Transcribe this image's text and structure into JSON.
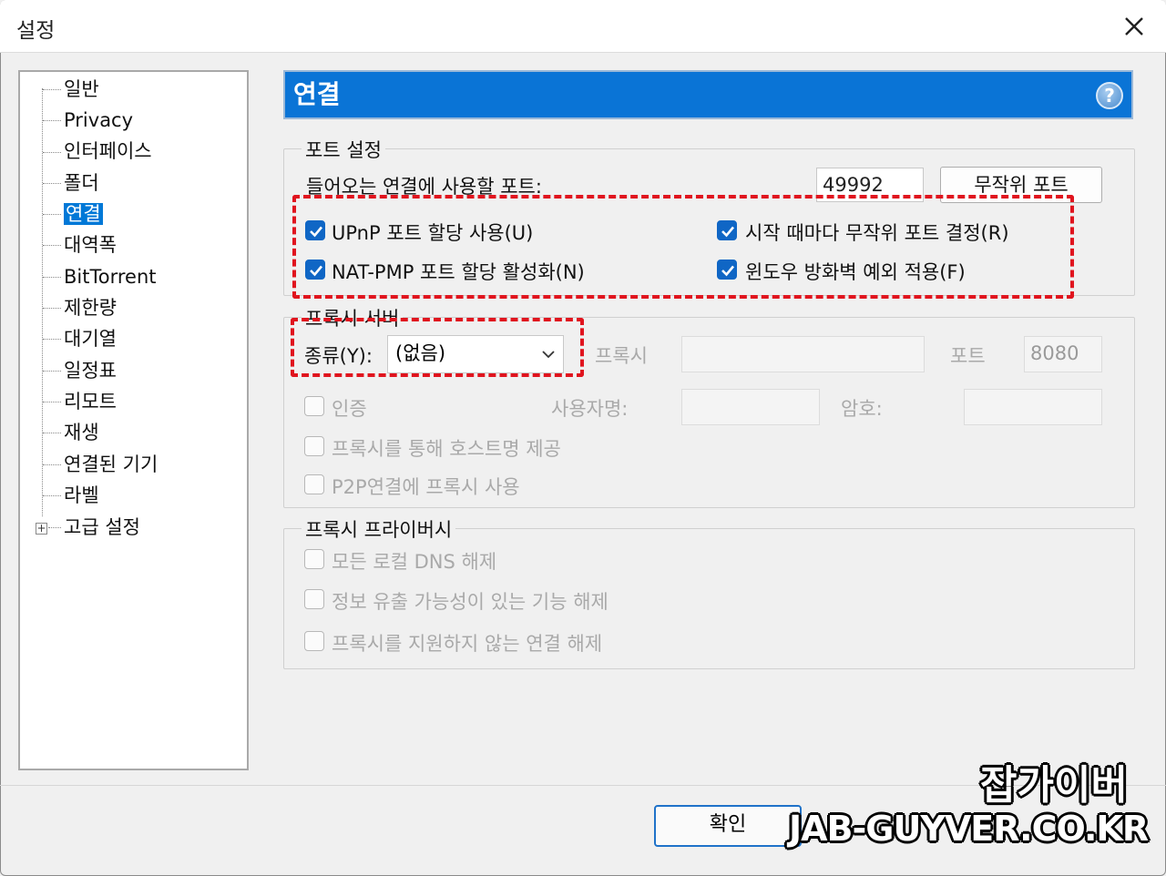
{
  "window": {
    "title": "설정"
  },
  "tree": {
    "items": [
      {
        "label": "일반"
      },
      {
        "label": "Privacy"
      },
      {
        "label": "인터페이스"
      },
      {
        "label": "폴더"
      },
      {
        "label": "연결"
      },
      {
        "label": "대역폭"
      },
      {
        "label": "BitTorrent"
      },
      {
        "label": "제한량"
      },
      {
        "label": "대기열"
      },
      {
        "label": "일정표"
      },
      {
        "label": "리모트"
      },
      {
        "label": "재생"
      },
      {
        "label": "연결된 기기"
      },
      {
        "label": "라벨"
      },
      {
        "label": "고급 설정"
      }
    ],
    "selected": "연결",
    "expander": "+"
  },
  "header": {
    "title": "연결",
    "help": "?"
  },
  "port_settings": {
    "title": "포트 설정",
    "incoming_label": "들어오는 연결에 사용할 포트:",
    "port_value": "49992",
    "random_port_button": "무작위 포트",
    "upnp_label": "UPnP 포트 할당 사용(U)",
    "natpmp_label": "NAT-PMP 포트 할당 활성화(N)",
    "random_each_start_label": "시작 때마다 무작위 포트 결정(R)",
    "firewall_label": "윈도우 방화벽 예외 적용(F)"
  },
  "proxy_server": {
    "title": "프록시 서버",
    "type_label": "종류(Y):",
    "type_value": "(없음)",
    "proxy_label": "프록시",
    "port_label": "포트",
    "port_value": "8080",
    "auth_label": "인증",
    "username_label": "사용자명:",
    "password_label": "암호:",
    "hostname_label": "프록시를 통해 호스트명 제공",
    "p2p_label": "P2P연결에 프록시 사용"
  },
  "proxy_privacy": {
    "title": "프록시 프라이버시",
    "dns_label": "모든 로컬 DNS 해제",
    "leak_label": "정보 유출 가능성이 있는 기능 해제",
    "unsupported_label": "프록시를 지원하지 않는 연결 해제"
  },
  "footer": {
    "ok_label": "확인"
  },
  "watermark": {
    "line1": "잡가이버",
    "line2": "JAB-GUYVER.CO.KR"
  },
  "colors": {
    "accent": "#0a74d6",
    "highlight": "#e0141e"
  }
}
